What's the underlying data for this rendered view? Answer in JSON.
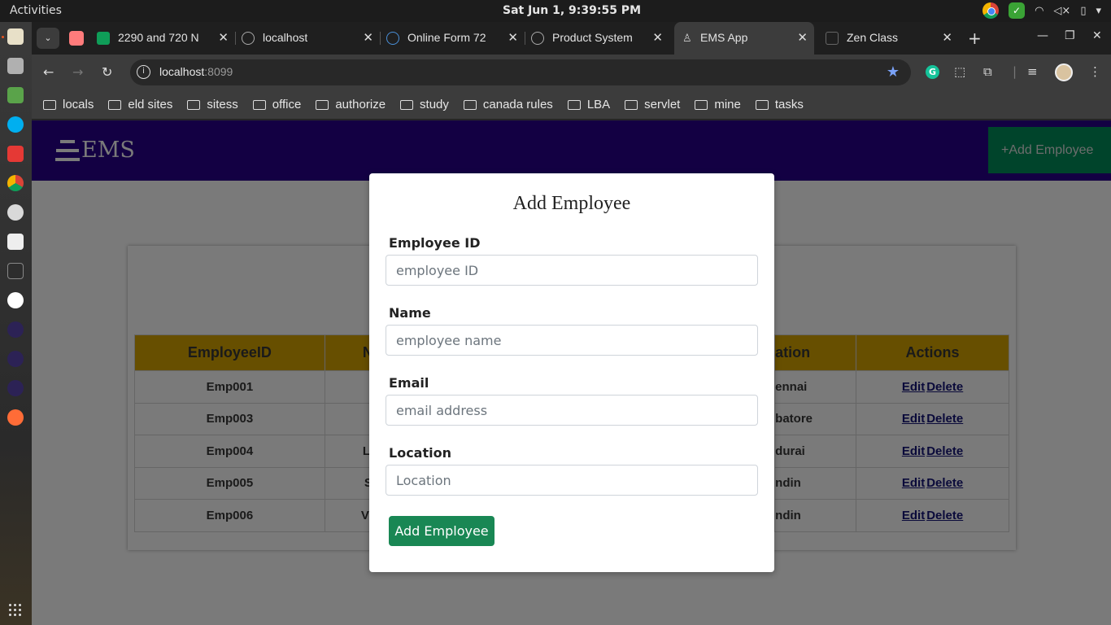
{
  "system": {
    "activities": "Activities",
    "clock": "Sat Jun  1,  9:39:55 PM"
  },
  "browser": {
    "tabs": [
      {
        "title": "2290 and 720 N",
        "favicon_color": "#0f9d58"
      },
      {
        "title": "localhost",
        "favicon_color": "#888888"
      },
      {
        "title": "Online Form 72",
        "favicon_color": "#4a90d9"
      },
      {
        "title": "Product System",
        "favicon_color": "#888888"
      },
      {
        "title": "EMS App",
        "favicon_color": "#888888",
        "active": true
      },
      {
        "title": "Zen Class",
        "favicon_color": "#555555"
      }
    ],
    "url_host": "localhost",
    "url_port": ":8099",
    "bookmarks": [
      "locals",
      "eld sites",
      "sitess",
      "office",
      "authorize",
      "study",
      "canada rules",
      "LBA",
      "servlet",
      "mine",
      "tasks"
    ]
  },
  "app": {
    "brand": "EMS",
    "nav_add_button": "Add Employee",
    "nav_add_icon": "+",
    "table": {
      "headers": [
        "EmployeeID",
        "N",
        "",
        "",
        "ation",
        "Actions"
      ],
      "rows": [
        {
          "id": "Emp001",
          "name": "",
          "location": "ennai"
        },
        {
          "id": "Emp003",
          "name": "",
          "location": "batore"
        },
        {
          "id": "Emp004",
          "name": "L",
          "location": "durai"
        },
        {
          "id": "Emp005",
          "name": "S",
          "location": "ndin"
        },
        {
          "id": "Emp006",
          "name": "V",
          "location": "ndin"
        }
      ],
      "edit_label": "Edit",
      "delete_label": "Delete"
    }
  },
  "modal": {
    "title": "Add Employee",
    "fields": [
      {
        "label": "Employee ID",
        "placeholder": "employee ID"
      },
      {
        "label": "Name",
        "placeholder": "employee name"
      },
      {
        "label": "Email",
        "placeholder": "email address"
      },
      {
        "label": "Location",
        "placeholder": "Location"
      }
    ],
    "submit_label": "Add Employee"
  }
}
